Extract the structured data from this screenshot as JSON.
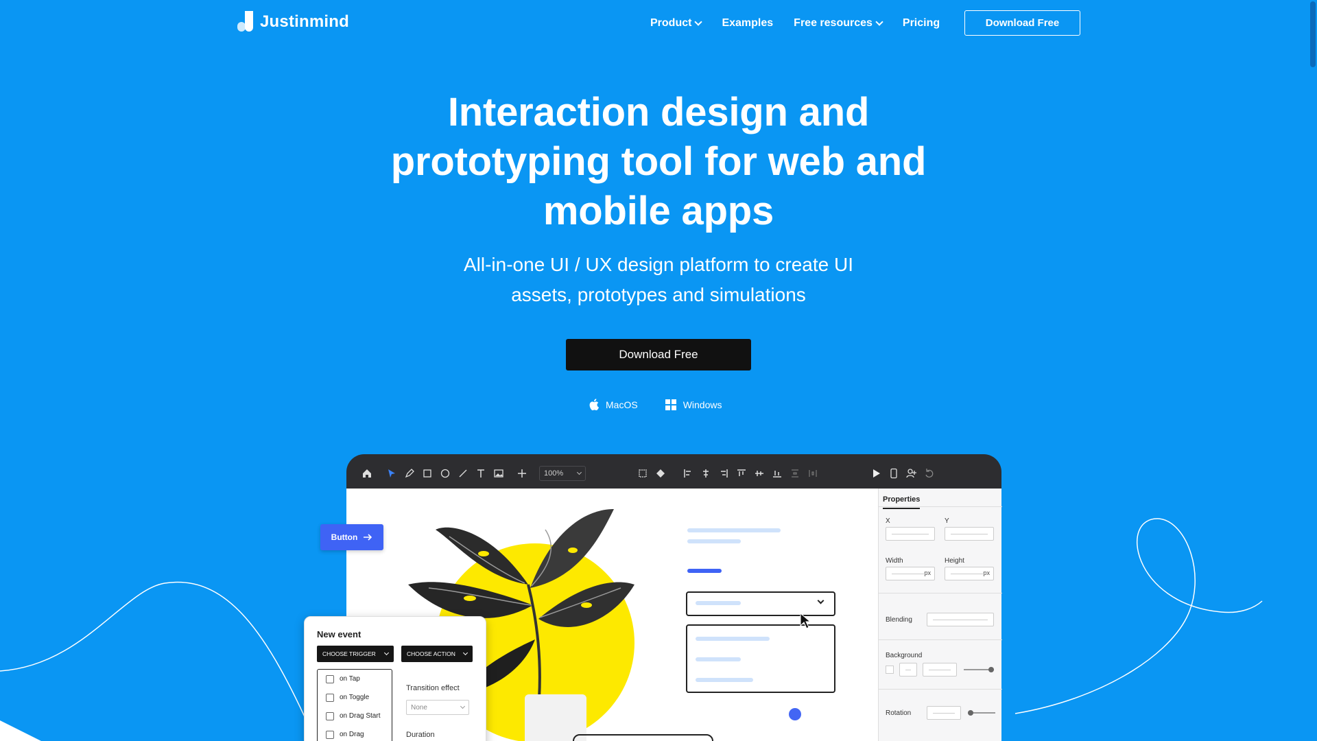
{
  "nav": {
    "logo_text": "Justinmind",
    "links": [
      {
        "label": "Product",
        "has_dropdown": true
      },
      {
        "label": "Examples",
        "has_dropdown": false
      },
      {
        "label": "Free resources",
        "has_dropdown": true
      },
      {
        "label": "Pricing",
        "has_dropdown": false
      }
    ],
    "download_label": "Download Free"
  },
  "hero": {
    "title_lines": [
      "Interaction design and",
      "prototyping tool for web and",
      "mobile apps"
    ],
    "subtitle_lines": [
      "All-in-one UI / UX design platform to create UI",
      "assets, prototypes and simulations"
    ],
    "cta_label": "Download Free",
    "platforms": [
      {
        "label": "MacOS",
        "icon": "apple-icon"
      },
      {
        "label": "Windows",
        "icon": "windows-icon"
      }
    ]
  },
  "mockup": {
    "zoom": "100%",
    "float_button_label": "Button",
    "properties": {
      "tab": "Properties",
      "x": "X",
      "y": "Y",
      "width": "Width",
      "height": "Height",
      "unit": "px",
      "blending": "Blending",
      "background": "Background",
      "rotation": "Rotation"
    },
    "event": {
      "title": "New event",
      "trigger": "CHOOSE TRIGGER",
      "action": "CHOOSE ACTION",
      "triggers": [
        "on Tap",
        "on Toggle",
        "on Drag Start",
        "on Drag"
      ],
      "transition_label": "Transition effect",
      "transition_value": "None",
      "duration_label": "Duration"
    }
  },
  "colors": {
    "background": "#0a96f3",
    "cta": "#111111",
    "accent": "#3f63f5",
    "highlight": "#fde900"
  }
}
